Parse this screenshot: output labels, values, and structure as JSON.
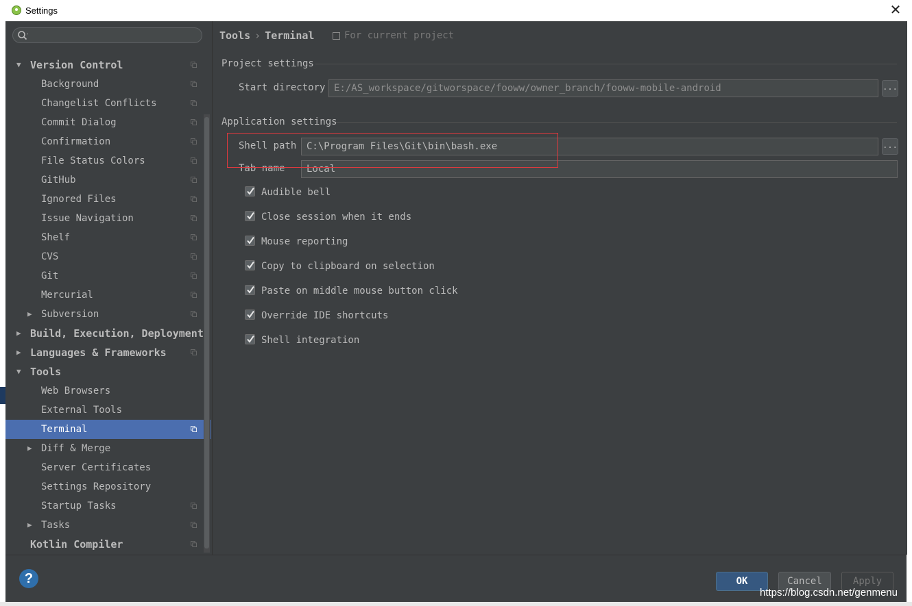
{
  "window": {
    "title": "Settings",
    "close_glyph": "✕"
  },
  "search": {
    "icon": "search-icon"
  },
  "tree": [
    {
      "label": "Version Control",
      "level": 0,
      "expander": "▼",
      "copy": true
    },
    {
      "label": "Background",
      "level": 1,
      "copy": true
    },
    {
      "label": "Changelist Conflicts",
      "level": 1,
      "copy": true
    },
    {
      "label": "Commit Dialog",
      "level": 1,
      "copy": true
    },
    {
      "label": "Confirmation",
      "level": 1,
      "copy": true
    },
    {
      "label": "File Status Colors",
      "level": 1,
      "copy": true
    },
    {
      "label": "GitHub",
      "level": 1,
      "copy": true
    },
    {
      "label": "Ignored Files",
      "level": 1,
      "copy": true
    },
    {
      "label": "Issue Navigation",
      "level": 1,
      "copy": true
    },
    {
      "label": "Shelf",
      "level": 1,
      "copy": true
    },
    {
      "label": "CVS",
      "level": 1,
      "copy": true
    },
    {
      "label": "Git",
      "level": 1,
      "copy": true
    },
    {
      "label": "Mercurial",
      "level": 1,
      "copy": true
    },
    {
      "label": "Subversion",
      "level": 1,
      "expander": "▶",
      "copy": true
    },
    {
      "label": "Build, Execution, Deployment",
      "level": 0,
      "expander": "▶",
      "copy": false
    },
    {
      "label": "Languages & Frameworks",
      "level": 0,
      "expander": "▶",
      "copy": true
    },
    {
      "label": "Tools",
      "level": 0,
      "expander": "▼",
      "copy": false
    },
    {
      "label": "Web Browsers",
      "level": 1,
      "copy": false
    },
    {
      "label": "External Tools",
      "level": 1,
      "copy": false
    },
    {
      "label": "Terminal",
      "level": 1,
      "copy": true,
      "selected": true
    },
    {
      "label": "Diff & Merge",
      "level": 1,
      "expander": "▶",
      "copy": false
    },
    {
      "label": "Server Certificates",
      "level": 1,
      "copy": false
    },
    {
      "label": "Settings Repository",
      "level": 1,
      "copy": false
    },
    {
      "label": "Startup Tasks",
      "level": 1,
      "copy": true
    },
    {
      "label": "Tasks",
      "level": 1,
      "expander": "▶",
      "copy": true
    },
    {
      "label": "Kotlin Compiler",
      "level": 0,
      "copy": true
    }
  ],
  "breadcrumb": {
    "parent": "Tools",
    "separator": "›",
    "current": "Terminal",
    "scope": "For current project"
  },
  "project_settings": {
    "heading": "Project settings",
    "start_directory_label": "Start directory",
    "start_directory_value": "E:/AS_workspace/gitworspace/fooww/owner_branch/fooww-mobile-android"
  },
  "application_settings": {
    "heading": "Application settings",
    "shell_path_label": "Shell path",
    "shell_path_value": "C:\\Program Files\\Git\\bin\\bash.exe",
    "tab_name_label": "Tab name",
    "tab_name_value": "Local",
    "browse_label": "..."
  },
  "checkboxes": [
    {
      "label": "Audible bell",
      "checked": true
    },
    {
      "label": "Close session when it ends",
      "checked": true
    },
    {
      "label": "Mouse reporting",
      "checked": true
    },
    {
      "label": "Copy to clipboard on selection",
      "checked": true
    },
    {
      "label": "Paste on middle mouse button click",
      "checked": true
    },
    {
      "label": "Override IDE shortcuts",
      "checked": true
    },
    {
      "label": "Shell integration",
      "checked": true
    }
  ],
  "footer": {
    "help": "?",
    "ok": "OK",
    "cancel": "Cancel",
    "apply": "Apply"
  },
  "watermark": "https://blog.csdn.net/genmenu",
  "colors": {
    "background": "#3c3f41",
    "selection": "#4b6eaf",
    "highlight": "#e0393e",
    "primary_button": "#365880"
  }
}
